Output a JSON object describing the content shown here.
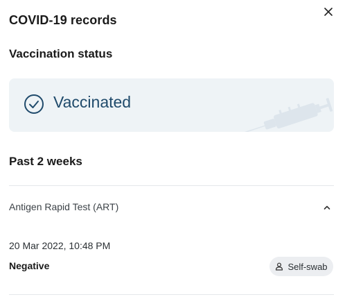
{
  "header": {
    "title": "COVID-19 records",
    "close_icon": "close-icon"
  },
  "vaccination": {
    "section_title": "Vaccination status",
    "status_label": "Vaccinated",
    "status_icon": "check-circle-icon",
    "decor_icon": "syringe-icon",
    "accent_color": "#1f4a6b",
    "card_color": "#eef3f6"
  },
  "tests": {
    "section_title": "Past 2 weeks",
    "items": [
      {
        "name": "Antigen Rapid Test (ART)",
        "expand_icon": "chevron-up-icon",
        "datetime": "20 Mar 2022, 10:48 PM",
        "result": "Negative",
        "method": "Self-swab",
        "method_icon": "person-icon"
      }
    ]
  }
}
